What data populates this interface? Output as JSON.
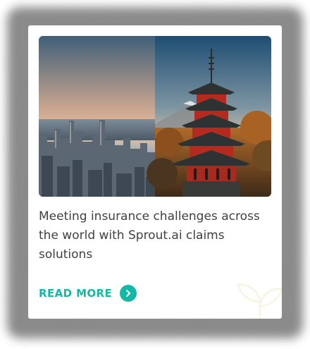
{
  "card": {
    "title": "Meeting insurance challenges across the world with Sprout.ai claims solutions",
    "image": {
      "left_scene": "city-skyline",
      "right_scene": "red-pagoda-with-mountain"
    },
    "cta": {
      "label": "READ MORE",
      "icon": "chevron-right-icon"
    },
    "decoration": "sprout-leaf-outline"
  },
  "colors": {
    "accent": "#14b8a6",
    "title_text": "#3f3f45",
    "card_bg": "#ffffff"
  }
}
